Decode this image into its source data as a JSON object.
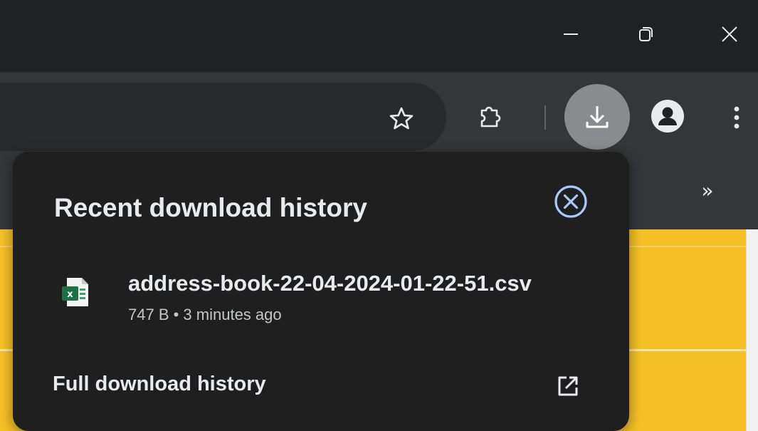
{
  "window": {
    "minimize_icon": "minimize-icon",
    "restore_icon": "restore-icon",
    "close_icon": "close-icon"
  },
  "toolbar": {
    "bookmark_icon": "star-icon",
    "extensions_icon": "puzzle-icon",
    "downloads_icon": "download-icon",
    "profile_icon": "person-icon",
    "menu_icon": "more-vert-icon"
  },
  "bookmarks_bar": {
    "overflow_label": "»"
  },
  "download_popup": {
    "title": "Recent download history",
    "items": [
      {
        "file_name": "address-book-22-04-2024-01-22-51.csv",
        "meta": "747 B • 3 minutes ago",
        "icon": "excel-file-icon"
      }
    ],
    "full_history_label": "Full download history"
  },
  "colors": {
    "titlebar": "#202124",
    "toolbar": "#35363a",
    "popup_bg": "#1f1f1f",
    "accent_blue": "#a8c7fa",
    "page_yellow": "#f6c025"
  }
}
